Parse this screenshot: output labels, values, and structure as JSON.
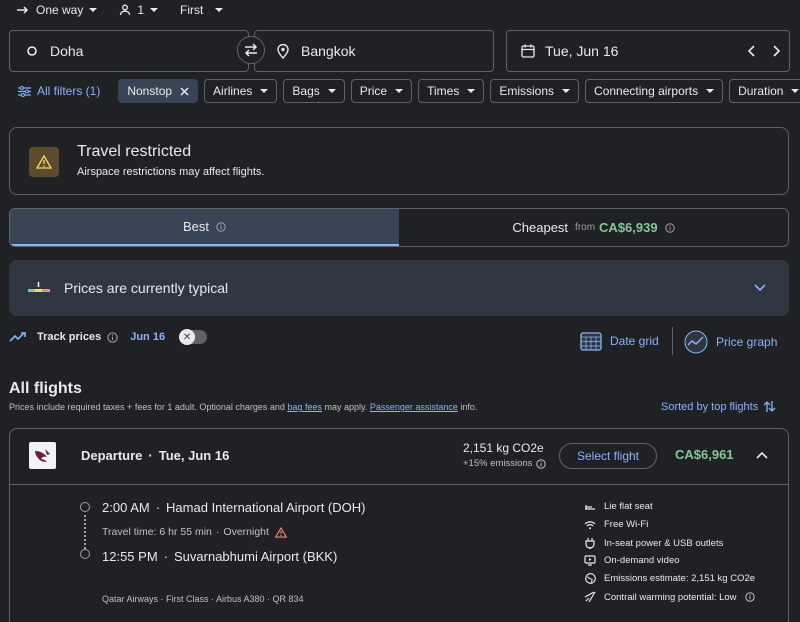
{
  "trip": {
    "type": "One way",
    "passengers": "1",
    "cabin": "First"
  },
  "search": {
    "origin": "Doha",
    "destination": "Bangkok",
    "date": "Tue, Jun 16"
  },
  "filters": {
    "all_label": "All filters (1)",
    "chips": [
      "Nonstop",
      "Airlines",
      "Bags",
      "Price",
      "Times",
      "Emissions",
      "Connecting airports",
      "Duration"
    ]
  },
  "notice": {
    "title": "Travel restricted",
    "body": "Airspace restrictions may affect flights."
  },
  "tabs": {
    "best": "Best",
    "cheapest": "Cheapest",
    "from": "from",
    "cheapest_price": "CA$6,939"
  },
  "insight": {
    "text": "Prices are currently typical"
  },
  "track": {
    "label": "Track prices",
    "date": "Jun 16",
    "date_grid": "Date grid",
    "price_graph": "Price graph"
  },
  "results": {
    "heading": "All flights",
    "note_before": "Prices include required taxes + fees for 1 adult. Optional charges and ",
    "bag_fees": "bag fees",
    "note_middle": " may apply. ",
    "passenger_assistance": "Passenger assistance",
    "note_after": " info.",
    "sort_label": "Sorted by top flights"
  },
  "flight": {
    "direction": "Departure",
    "sep": "·",
    "date": "Tue, Jun 16",
    "emissions": "2,151 kg CO2e",
    "emissions_delta": "+15% emissions",
    "select_label": "Select flight",
    "price": "CA$6,961",
    "dep_time": "2:00 AM",
    "dep_airport": "Hamad International Airport (DOH)",
    "travel_time": "Travel time: 6 hr 55 min",
    "overnight": "Overnight",
    "arr_time": "12:55 PM",
    "arr_airport": "Suvarnabhumi Airport (BKK)",
    "details": "Qatar Airways · First Class · Airbus A380 · QR 834",
    "amenities": [
      "Lie flat seat",
      "Free Wi-Fi",
      "In-seat power & USB outlets",
      "On-demand video",
      "Emissions estimate: 2,151 kg CO2e",
      "Contrail warming potential: Low"
    ]
  },
  "colors": {
    "accent": "#8ab4f8",
    "price_green": "#81c995",
    "background": "#202124",
    "selected": "#394457",
    "warning": "#f28b82"
  }
}
